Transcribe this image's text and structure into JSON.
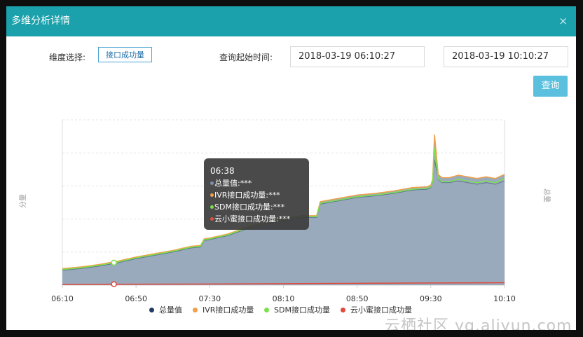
{
  "dialog": {
    "title": "多维分析详情",
    "close_glyph": "×"
  },
  "form": {
    "dimension_label": "维度选择:",
    "dimension_value": "接口成功量",
    "time_label": "查询起始时间:",
    "start_time": "2018-03-19 06:10:27",
    "end_time": "2018-03-19 10:10:27",
    "query_button": "查询"
  },
  "tooltip": {
    "time": "06:38",
    "rows": [
      {
        "name": "总量值",
        "value": "***",
        "color": "#7b8fae"
      },
      {
        "name": "IVR接口成功量",
        "value": "***",
        "color": "#f0a04a"
      },
      {
        "name": "SDM接口成功量",
        "value": "***",
        "color": "#7ee04d"
      },
      {
        "name": "云小蜜接口成功量",
        "value": "***",
        "color": "#e05040"
      }
    ]
  },
  "watermark": "云栖社区 yq.aliyun.com",
  "colors": {
    "header": "#1aa1ac",
    "total": "#1f3b63",
    "ivr": "#f0a04a",
    "sdm": "#7ee04d",
    "xiaomi": "#e04a3c",
    "area_fill": "#9aaabd"
  },
  "chart_data": {
    "type": "area",
    "x_ticks": [
      "06:10",
      "06:50",
      "07:30",
      "08:10",
      "08:50",
      "09:30",
      "10:10"
    ],
    "x_range_minutes": [
      0,
      240
    ],
    "y_range": [
      0,
      100
    ],
    "left_axis_label": "分量",
    "right_axis_label": "总量",
    "legend_position": "bottom",
    "legend": [
      "总量值",
      "IVR接口成功量",
      "SDM接口成功量",
      "云小蜜接口成功量"
    ],
    "series": [
      {
        "name": "总量值",
        "x": [
          0,
          10,
          20,
          30,
          40,
          50,
          60,
          70,
          75,
          77,
          80,
          90,
          100,
          110,
          130,
          138,
          140,
          150,
          160,
          170,
          180,
          190,
          198,
          200,
          201,
          202,
          204,
          206,
          210,
          215,
          220,
          225,
          230,
          235,
          240
        ],
        "values": [
          9,
          10,
          11.5,
          13.5,
          16,
          18,
          20,
          22.5,
          23,
          27,
          27.5,
          30,
          34,
          37,
          41,
          41,
          49,
          51,
          53,
          54,
          55.5,
          57.5,
          58,
          59,
          62,
          76,
          64,
          62,
          62,
          63,
          62,
          61,
          62,
          61,
          63
        ]
      },
      {
        "name": "IVR接口成功量",
        "x": [
          0,
          10,
          20,
          30,
          40,
          50,
          60,
          70,
          75,
          77,
          80,
          90,
          100,
          110,
          130,
          138,
          140,
          150,
          160,
          170,
          180,
          190,
          198,
          200,
          201,
          202,
          204,
          206,
          210,
          215,
          220,
          225,
          230,
          235,
          240
        ],
        "values": [
          10,
          11,
          12.5,
          14.5,
          17,
          19,
          21,
          23.5,
          24,
          28,
          28.5,
          31,
          35,
          38,
          42,
          42,
          50.5,
          52.5,
          54.5,
          55.5,
          57,
          59,
          59.5,
          60.5,
          64,
          91,
          67,
          65,
          65,
          66.5,
          65.5,
          64.5,
          65.5,
          64.5,
          67
        ]
      },
      {
        "name": "SDM接口成功量",
        "x": [
          0,
          10,
          20,
          30,
          40,
          50,
          60,
          70,
          75,
          77,
          80,
          90,
          100,
          110,
          130,
          138,
          140,
          150,
          160,
          170,
          180,
          190,
          198,
          200,
          201,
          202,
          204,
          206,
          210,
          215,
          220,
          225,
          230,
          235,
          240
        ],
        "values": [
          9.5,
          10.5,
          12,
          14,
          16.5,
          18.5,
          20.5,
          23,
          23.5,
          27.5,
          28,
          30.5,
          34.5,
          37.5,
          41.5,
          41.5,
          49.5,
          51.5,
          53.5,
          54.5,
          56,
          58,
          58.5,
          59.5,
          62.5,
          83,
          64.5,
          62.5,
          62.5,
          64,
          63,
          62,
          63,
          62,
          64.5
        ]
      },
      {
        "name": "云小蜜接口成功量",
        "x": [
          0,
          40,
          80,
          120,
          160,
          200,
          240
        ],
        "values": [
          0.5,
          0.6,
          0.7,
          0.9,
          1.1,
          1.3,
          1.5
        ]
      }
    ]
  }
}
